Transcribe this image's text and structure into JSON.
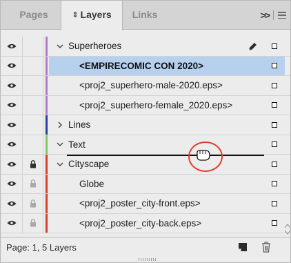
{
  "tabs": [
    {
      "label": "Pages",
      "icon": ""
    },
    {
      "label": "Layers",
      "icon": "updown-arrows-icon"
    },
    {
      "label": "Links",
      "icon": ""
    }
  ],
  "panel_menu": {
    "collapse_glyph": ">>"
  },
  "layers": [
    {
      "label": "Superheroes",
      "type": "layer",
      "expanded": true,
      "color": "#b07cc6",
      "locked": false,
      "visible": true,
      "selected": false,
      "pen": true
    },
    {
      "label": "<EMPIRECOMIC CON 2020>",
      "type": "item",
      "color": "#b07cc6",
      "locked": false,
      "visible": true,
      "selected": true
    },
    {
      "label": "<proj2_superhero-male-2020.eps>",
      "type": "item",
      "color": "#b07cc6",
      "locked": false,
      "visible": true,
      "selected": false
    },
    {
      "label": "<proj2_superhero-female_2020.eps>",
      "type": "item",
      "color": "#b07cc6",
      "locked": false,
      "visible": true,
      "selected": false
    },
    {
      "label": "Lines",
      "type": "layer",
      "expanded": false,
      "color": "#2b3c9c",
      "locked": false,
      "visible": true,
      "selected": false
    },
    {
      "label": "Text",
      "type": "layer",
      "expanded": true,
      "color": "#7fc75a",
      "locked": false,
      "visible": true,
      "selected": false
    },
    {
      "label": "Cityscape",
      "type": "layer",
      "expanded": true,
      "color": "#d6402b",
      "locked": true,
      "visible": true,
      "selected": false
    },
    {
      "label": "Globe",
      "type": "item",
      "color": "#d6402b",
      "locked": "inherited",
      "visible": true,
      "selected": false
    },
    {
      "label": "<proj2_poster_city-front.eps>",
      "type": "item",
      "color": "#d6402b",
      "locked": "inherited",
      "visible": true,
      "selected": false
    },
    {
      "label": "<proj2_poster_city-back.eps>",
      "type": "item",
      "color": "#d6402b",
      "locked": "inherited",
      "visible": true,
      "selected": false
    }
  ],
  "footer": {
    "status": "Page: 1, 5 Layers"
  },
  "colors": {
    "selection": "#b6d0ee",
    "highlight_ring": "#e23b2e"
  }
}
